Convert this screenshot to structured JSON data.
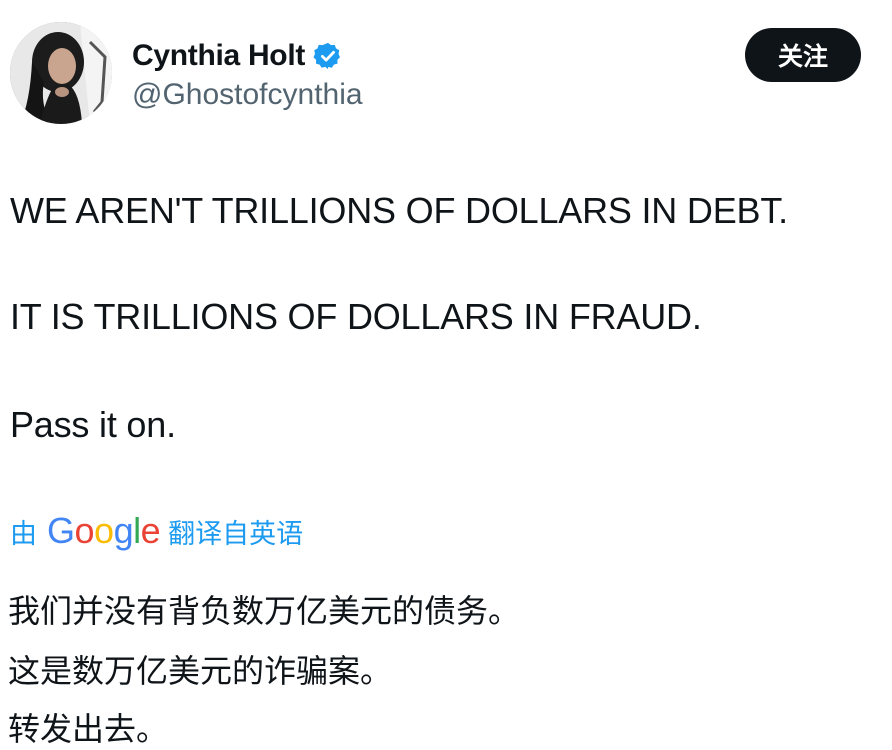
{
  "author": {
    "display_name": "Cynthia Holt",
    "handle": "@Ghostofcynthia",
    "verified_color": "#1d9bf0"
  },
  "follow_button": {
    "label": "关注"
  },
  "tweet": {
    "lines": [
      "WE AREN'T TRILLIONS OF DOLLARS IN DEBT.",
      "IT IS TRILLIONS OF DOLLARS IN FRAUD.",
      "Pass it on."
    ]
  },
  "translation": {
    "prefix": "由",
    "provider": "Google",
    "suffix": "翻译自英语",
    "accent_color": "#1d9bf0",
    "lines": [
      "我们并没有背负数万亿美元的债务。",
      "这是数万亿美元的诈骗案。",
      "转发出去。"
    ]
  }
}
